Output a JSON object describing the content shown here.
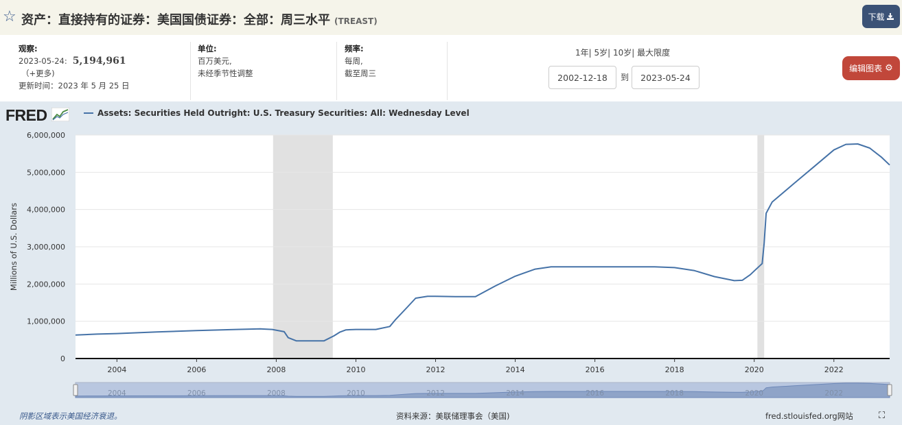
{
  "header": {
    "title": "资产：直接持有的证券：美国国债证券：全部：周三水平",
    "series_id": "(TREAST)",
    "download_label": "下载"
  },
  "info": {
    "observation_label": "观察:",
    "observation_date": "2023-05-24:",
    "observation_value": "5,194,961",
    "more_label": "（+更多)",
    "updated_label": "更新时间：2023 年 5 月 25 日",
    "units_label": "单位:",
    "units_line1": "百万美元,",
    "units_line2": "未经季节性调整",
    "frequency_label": "频率:",
    "frequency_line1": "每周,",
    "frequency_line2": "截至周三"
  },
  "range_controls": {
    "r1": "1年",
    "r5": "5岁",
    "r10": "10岁",
    "rmax": "最大限度",
    "start_date": "2002-12-18",
    "to_label": "到",
    "end_date": "2023-05-24",
    "edit_label": "编辑图表"
  },
  "logo": "FRED",
  "footer": {
    "recession_note": "阴影区域表示美国经济衰退。",
    "source": "资料来源：美联储理事会（美国)",
    "site": "fred.stlouisfed.org网站"
  },
  "colors": {
    "line": "#4572a7",
    "recession": "#e1e1e1",
    "chart_bg": "#e1e9f0",
    "edit_button": "#c1473a",
    "download_button": "#3b5276"
  },
  "chart_data": {
    "type": "line",
    "title": "",
    "ylabel": "Millions of U.S. Dollars",
    "xlabel": "",
    "xlim": [
      2002.96,
      2023.4
    ],
    "ylim": [
      0,
      6000000
    ],
    "x_ticks": [
      2004,
      2006,
      2008,
      2010,
      2012,
      2014,
      2016,
      2018,
      2020,
      2022
    ],
    "x_tick_labels": [
      "2004",
      "2006",
      "2008",
      "2010",
      "2012",
      "2014",
      "2016",
      "2018",
      "2020",
      "2022"
    ],
    "y_ticks": [
      0,
      1000000,
      2000000,
      3000000,
      4000000,
      5000000,
      6000000
    ],
    "y_tick_labels": [
      "0",
      "1,000,000",
      "2,000,000",
      "3,000,000",
      "4,000,000",
      "5,000,000",
      "6,000,000"
    ],
    "recessions": [
      [
        2007.92,
        2009.42
      ],
      [
        2020.08,
        2020.25
      ]
    ],
    "grid": "horizontal",
    "series": [
      {
        "name": "Assets: Securities Held Outright: U.S. Treasury Securities: All: Wednesday Level",
        "x": [
          2002.96,
          2003.5,
          2004,
          2005,
          2006,
          2007,
          2007.6,
          2007.9,
          2008.2,
          2008.3,
          2008.5,
          2008.8,
          2009.0,
          2009.2,
          2009.45,
          2009.6,
          2009.75,
          2010,
          2010.5,
          2010.85,
          2011.0,
          2011.3,
          2011.5,
          2011.8,
          2012,
          2012.5,
          2013.0,
          2013.5,
          2014,
          2014.5,
          2014.9,
          2015.5,
          2016.5,
          2017.5,
          2018.0,
          2018.5,
          2019.0,
          2019.5,
          2019.7,
          2019.9,
          2020.0,
          2020.15,
          2020.2,
          2020.25,
          2020.3,
          2020.45,
          2021.0,
          2021.5,
          2022.0,
          2022.3,
          2022.6,
          2022.9,
          2023.2,
          2023.4
        ],
        "y": [
          630000,
          655000,
          670000,
          715000,
          750000,
          780000,
          795000,
          780000,
          720000,
          560000,
          475000,
          475000,
          475000,
          475000,
          610000,
          710000,
          770000,
          780000,
          780000,
          860000,
          1050000,
          1390000,
          1620000,
          1670000,
          1670000,
          1660000,
          1660000,
          1950000,
          2210000,
          2400000,
          2460000,
          2460000,
          2460000,
          2460000,
          2440000,
          2360000,
          2200000,
          2090000,
          2100000,
          2250000,
          2350000,
          2500000,
          2550000,
          3100000,
          3900000,
          4200000,
          4700000,
          5150000,
          5600000,
          5750000,
          5760000,
          5650000,
          5400000,
          5194961
        ]
      }
    ]
  }
}
